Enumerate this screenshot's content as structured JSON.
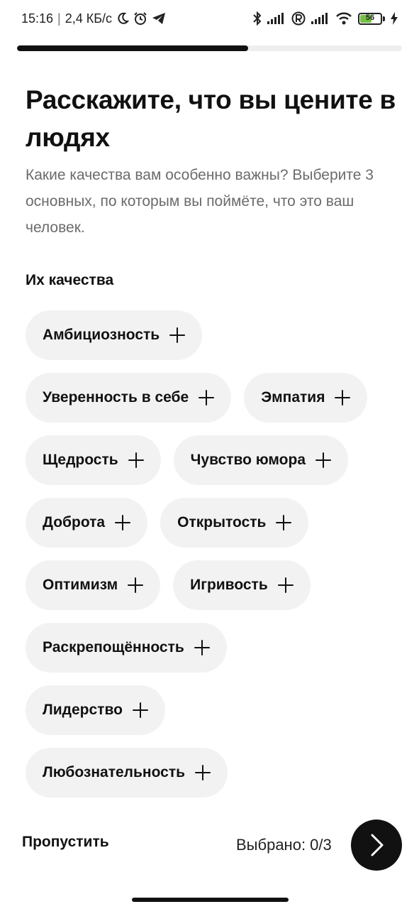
{
  "status_bar": {
    "time": "15:16",
    "network_speed": "2,4 КБ/с",
    "battery_level": "56",
    "battery_fraction": 0.56,
    "battery_color": "#76c043",
    "icons": [
      "moon-icon",
      "alarm-icon",
      "telegram-icon",
      "bluetooth-icon",
      "signal-icon",
      "roaming-icon",
      "signal-icon",
      "wifi-icon",
      "battery-icon",
      "charging-icon"
    ]
  },
  "progress": {
    "fraction": 0.6
  },
  "header": {
    "title": "Расскажите, что вы цените в людях",
    "subtitle": "Какие качества вам особенно важны? Выберите 3 основных, по которым вы поймёте, что это ваш человек."
  },
  "section": {
    "label": "Их качества"
  },
  "qualities": [
    [
      "Амбициозность"
    ],
    [
      "Уверенность в себе",
      "Эмпатия"
    ],
    [
      "Щедрость",
      "Чувство юмора"
    ],
    [
      "Доброта",
      "Открытость"
    ],
    [
      "Оптимизм",
      "Игривость"
    ],
    [
      "Раскрепощённость"
    ],
    [
      "Лидерство"
    ],
    [
      "Любознательность"
    ]
  ],
  "footer": {
    "skip_label": "Пропустить",
    "selected_label": "Выбрано: 0/3",
    "next_icon": "chevron-right-icon"
  },
  "colors": {
    "accent": "#111111",
    "chip_background": "#f2f2f2",
    "muted_text": "#6b6b6b"
  }
}
